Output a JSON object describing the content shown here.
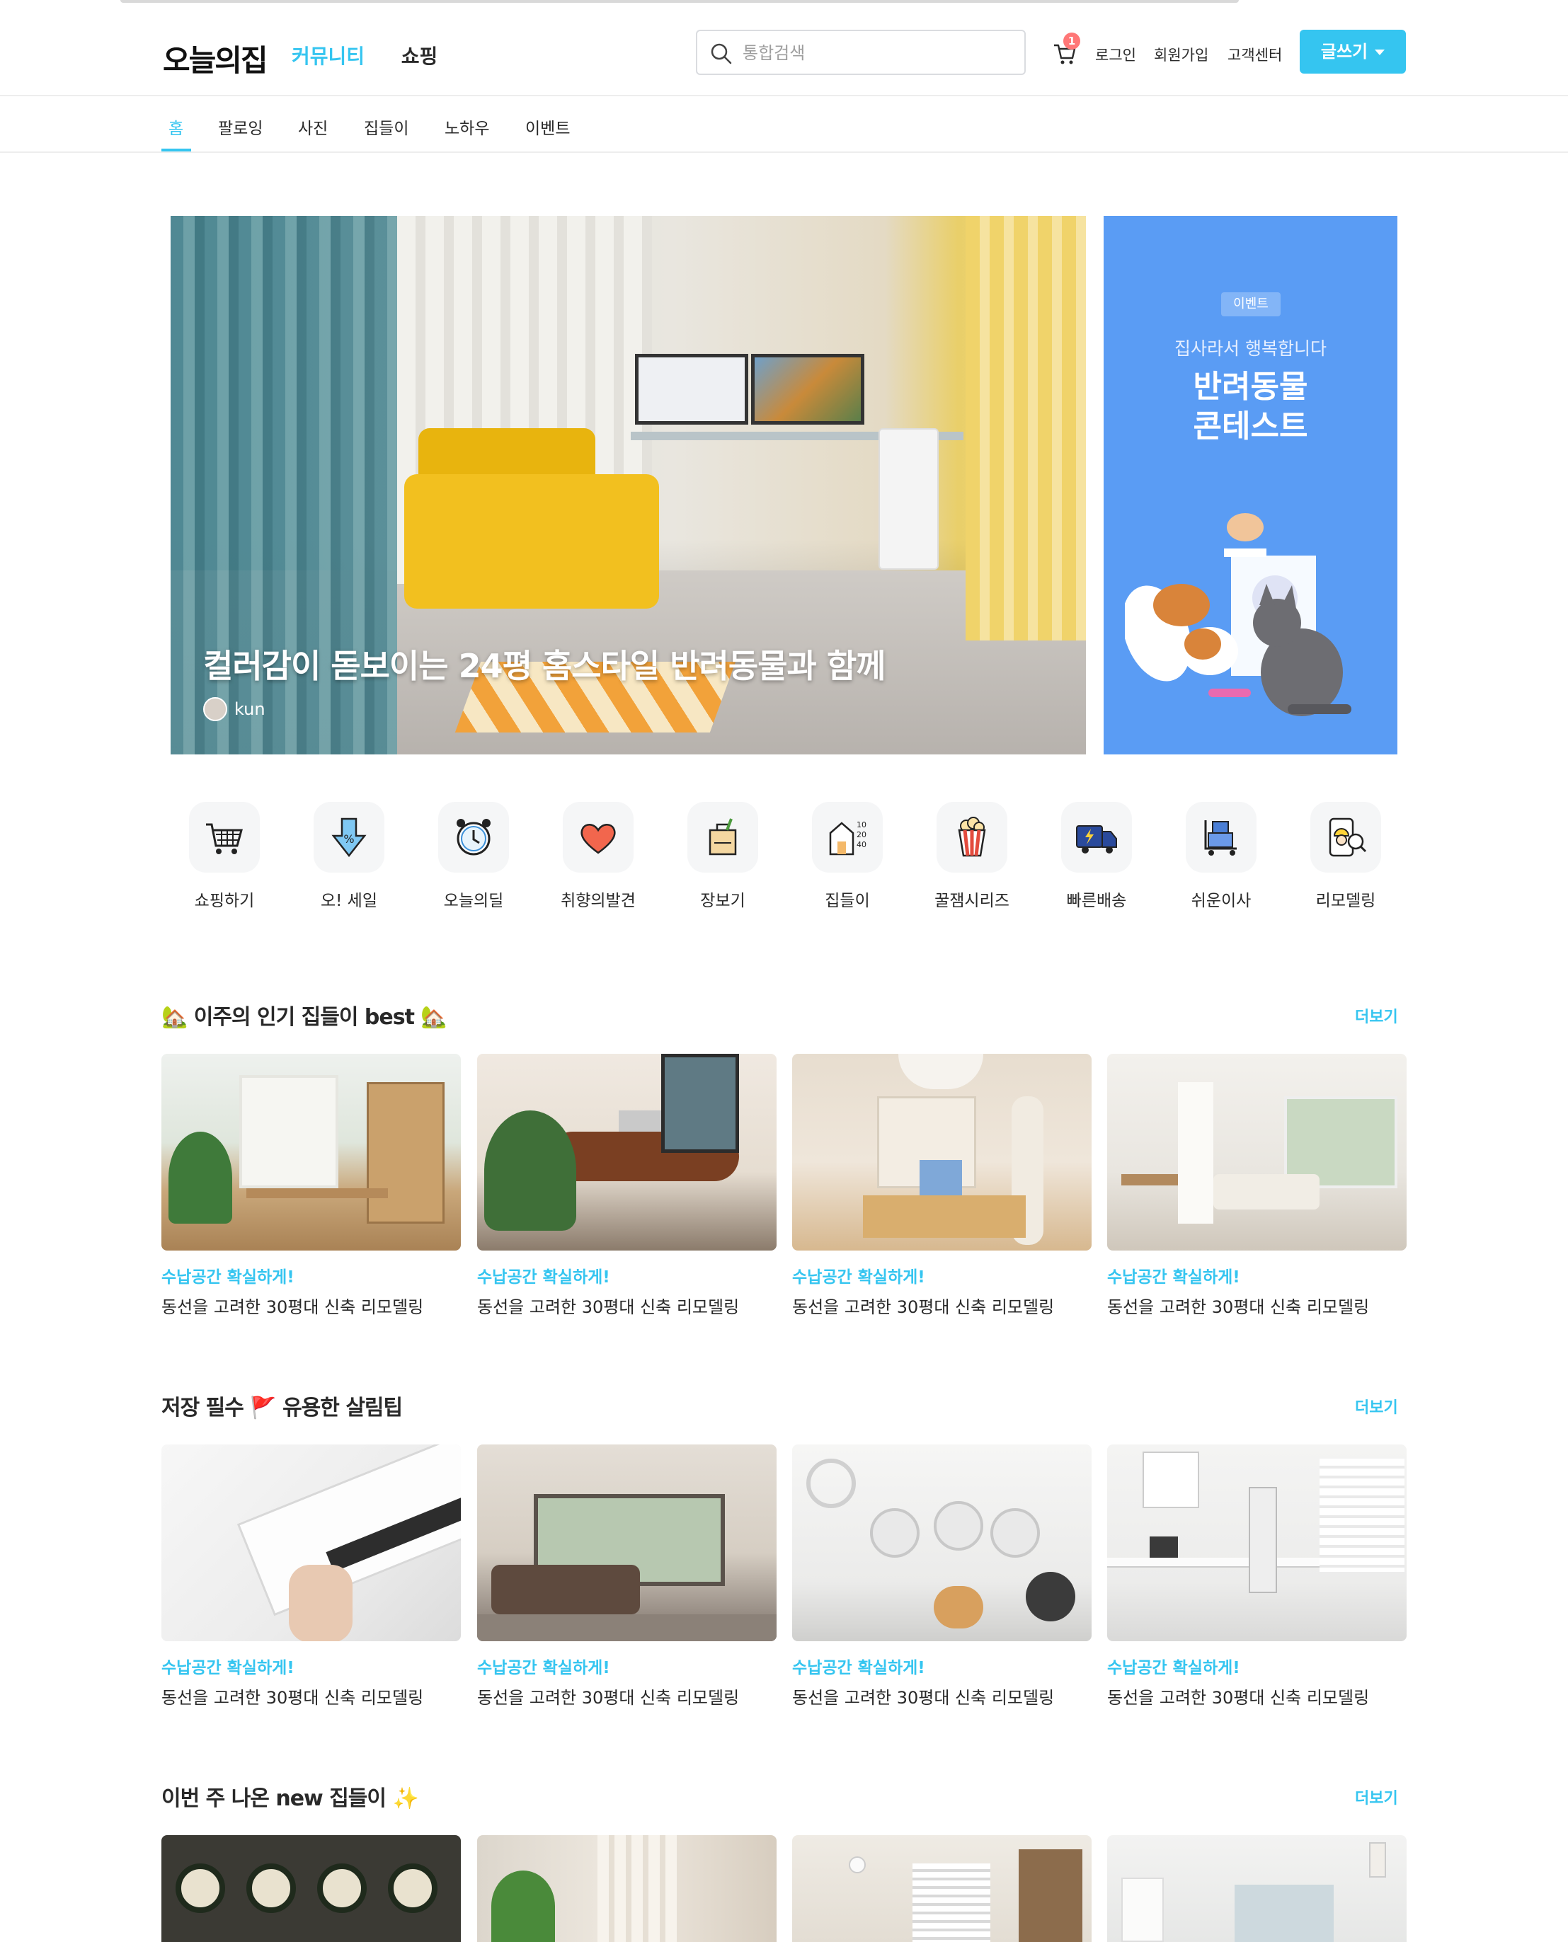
{
  "header": {
    "logo": "오늘의집",
    "nav": [
      "커뮤니티",
      "쇼핑"
    ],
    "search_placeholder": "통합검색",
    "cart_count": "1",
    "login": "로그인",
    "signup": "회원가입",
    "support": "고객센터",
    "write": "글쓰기"
  },
  "subnav": [
    "홈",
    "팔로잉",
    "사진",
    "집들이",
    "노하우",
    "이벤트"
  ],
  "hero": {
    "title": "컬러감이 돋보이는 24평 홈스타일 반려동물과 함께",
    "author": "kun"
  },
  "event": {
    "tag": "이벤트",
    "subtitle": "집사라서 행복합니다",
    "title_line1": "반려동물",
    "title_line2": "콘테스트"
  },
  "categories": [
    {
      "label": "쇼핑하기",
      "icon": "shopping-cart-icon"
    },
    {
      "label": "오! 세일",
      "icon": "sale-arrow-icon"
    },
    {
      "label": "오늘의딜",
      "icon": "alarm-clock-icon"
    },
    {
      "label": "취향의발견",
      "icon": "heart-icon"
    },
    {
      "label": "장보기",
      "icon": "grocery-bag-icon"
    },
    {
      "label": "집들이",
      "icon": "house-icon"
    },
    {
      "label": "꿀잼시리즈",
      "icon": "popcorn-icon"
    },
    {
      "label": "빠른배송",
      "icon": "delivery-truck-icon"
    },
    {
      "label": "쉬운이사",
      "icon": "moving-cart-icon"
    },
    {
      "label": "리모델링",
      "icon": "remodeling-icon"
    }
  ],
  "sections": [
    {
      "title": "🏡 이주의 인기 집들이 best 🏡",
      "more": "더보기",
      "cards": [
        {
          "tag": "수납공간 확실하게!",
          "name": "동선을 고려한 30평대 신축 리모델링"
        },
        {
          "tag": "수납공간 확실하게!",
          "name": "동선을 고려한 30평대 신축 리모델링"
        },
        {
          "tag": "수납공간 확실하게!",
          "name": "동선을 고려한 30평대 신축 리모델링"
        },
        {
          "tag": "수납공간 확실하게!",
          "name": "동선을 고려한 30평대 신축 리모델링"
        }
      ]
    },
    {
      "title": "저장 필수 🚩 유용한 살림팁",
      "more": "더보기",
      "cards": [
        {
          "tag": "수납공간 확실하게!",
          "name": "동선을 고려한 30평대 신축 리모델링"
        },
        {
          "tag": "수납공간 확실하게!",
          "name": "동선을 고려한 30평대 신축 리모델링"
        },
        {
          "tag": "수납공간 확실하게!",
          "name": "동선을 고려한 30평대 신축 리모델링"
        },
        {
          "tag": "수납공간 확실하게!",
          "name": "동선을 고려한 30평대 신축 리모델링"
        }
      ]
    },
    {
      "title": "이번 주 나온 new 집들이 ✨",
      "more": "더보기"
    }
  ],
  "colors": {
    "accent": "#35c5f0",
    "event_bg": "#5a9cf4",
    "text": "#292929"
  }
}
